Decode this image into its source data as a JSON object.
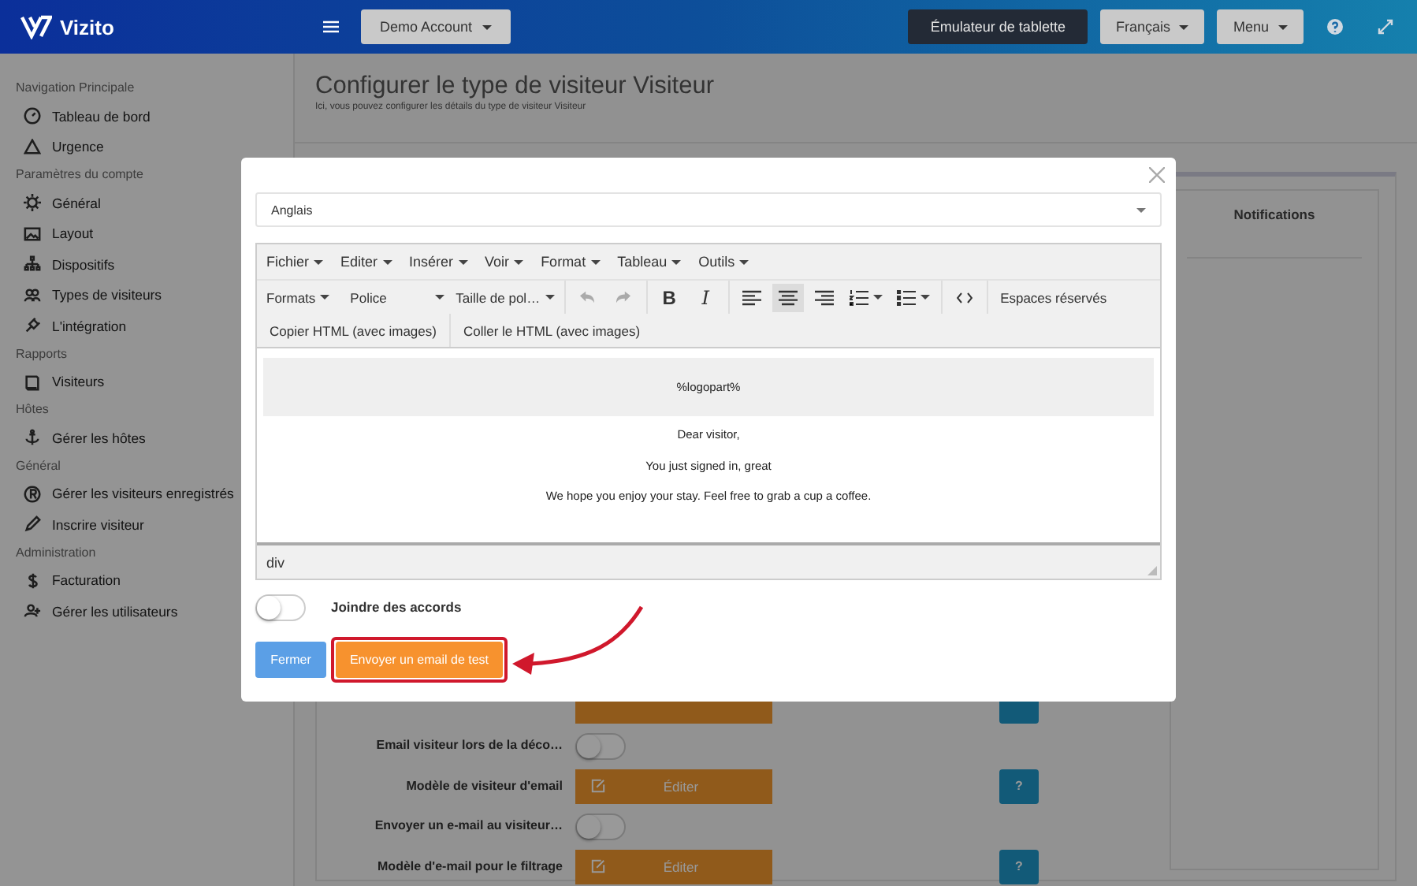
{
  "topbar": {
    "brand": "Vizito",
    "account_button": "Demo Account",
    "tablet_button": "Émulateur de tablette",
    "language_button": "Français",
    "menu_button": "Menu"
  },
  "sidebar": {
    "sections": [
      {
        "title": "Navigation Principale",
        "items": [
          {
            "label": "Tableau de bord"
          },
          {
            "label": "Urgence"
          }
        ]
      },
      {
        "title": "Paramètres du compte",
        "items": [
          {
            "label": "Général"
          },
          {
            "label": "Layout"
          },
          {
            "label": "Dispositifs"
          },
          {
            "label": "Types de visiteurs"
          },
          {
            "label": "L'intégration"
          }
        ]
      },
      {
        "title": "Rapports",
        "items": [
          {
            "label": "Visiteurs"
          }
        ]
      },
      {
        "title": "Hôtes",
        "items": [
          {
            "label": "Gérer les hôtes"
          }
        ]
      },
      {
        "title": "Général",
        "items": [
          {
            "label": "Gérer les visiteurs enregistrés"
          },
          {
            "label": "Inscrire visiteur"
          }
        ]
      },
      {
        "title": "Administration",
        "items": [
          {
            "label": "Facturation"
          },
          {
            "label": "Gérer les utilisateurs"
          }
        ]
      }
    ]
  },
  "page": {
    "title": "Configurer le type de visiteur Visiteur",
    "subtitle": "Ici, vous pouvez configurer les détails du type de visiteur Visiteur",
    "notifications_header": "Notifications",
    "settings": [
      {
        "kind": "covered-editor"
      },
      {
        "kind": "toggle",
        "label": "Email visiteur lors de la déco…",
        "on": false
      },
      {
        "kind": "editor",
        "label": "Modèle de visiteur d'email",
        "button": "Éditer",
        "help": "?"
      },
      {
        "kind": "toggle",
        "label": "Envoyer un e-mail au visiteur…",
        "on": false
      },
      {
        "kind": "editor",
        "label": "Modèle d'e-mail pour le filtrage",
        "button": "Éditer",
        "help": "?"
      }
    ]
  },
  "modal": {
    "language_select": "Anglais",
    "editor": {
      "menu": [
        "Fichier",
        "Editer",
        "Insérer",
        "Voir",
        "Format",
        "Tableau",
        "Outils"
      ],
      "toolbar_groups": [
        [
          {
            "kind": "dropdown",
            "label": "Formats"
          },
          {
            "kind": "wide-dropdown",
            "label": "Police"
          },
          {
            "kind": "dropdown",
            "label": "Taille de pol…"
          }
        ],
        [
          {
            "kind": "undo",
            "disabled": true
          },
          {
            "kind": "redo",
            "disabled": true
          }
        ],
        [
          {
            "kind": "bold",
            "label": "B"
          },
          {
            "kind": "italic",
            "label": "I"
          }
        ],
        [
          {
            "kind": "align-left",
            "selected": false
          },
          {
            "kind": "align-center",
            "selected": true
          },
          {
            "kind": "align-right",
            "selected": false
          },
          {
            "kind": "ordered-list"
          },
          {
            "kind": "bullet-list"
          }
        ],
        [
          {
            "kind": "code"
          }
        ],
        [
          {
            "kind": "text",
            "label": "Espaces réservés"
          }
        ],
        [
          {
            "kind": "text",
            "label": "Copier HTML (avec images)"
          }
        ],
        [
          {
            "kind": "text",
            "label": "Coller le HTML (avec images)"
          }
        ]
      ],
      "logo_placeholder": "%logopart%",
      "paragraphs": [
        "Dear visitor,",
        "You just signed in, great",
        "We hope you enjoy your stay. Feel free to grab a cup a coffee."
      ],
      "status_path": "div"
    },
    "attach_toggle": {
      "label": "Joindre des accords",
      "on": false
    },
    "buttons": {
      "close": "Fermer",
      "send_test": "Envoyer un email de test"
    },
    "send_test_highlighted": true
  }
}
